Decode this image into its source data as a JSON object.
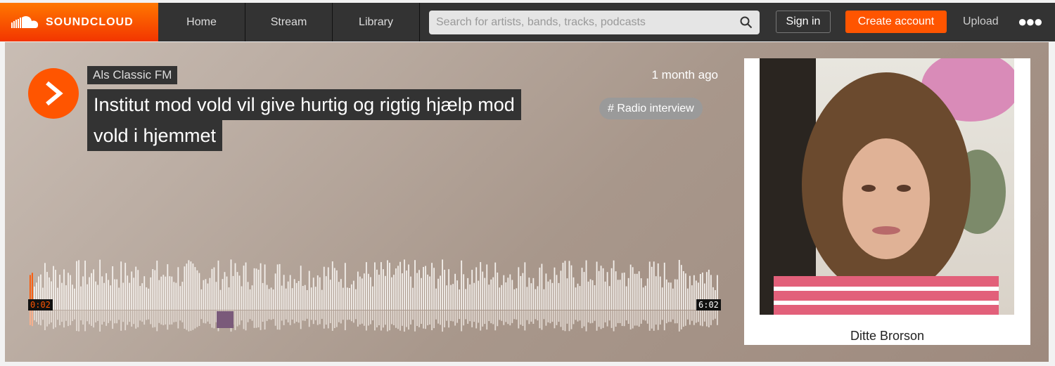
{
  "nav": {
    "brand": "SOUNDCLOUD",
    "tabs": [
      "Home",
      "Stream",
      "Library"
    ],
    "search_placeholder": "Search for artists, bands, tracks, podcasts",
    "signin": "Sign in",
    "create": "Create account",
    "upload": "Upload"
  },
  "track": {
    "artist": "Als Classic FM",
    "title_line1": "Institut mod vold vil give hurtig og rigtig hjælp mod",
    "title_line2": "vold i hjemmet",
    "posted": "1 month ago",
    "tag": "# Radio interview",
    "elapsed": "0:02",
    "duration": "6:02",
    "progress_fraction": 0.0055
  },
  "artwork": {
    "caption": "Ditte Brorson"
  },
  "colors": {
    "accent": "#ff5500",
    "topbar": "#333333"
  }
}
